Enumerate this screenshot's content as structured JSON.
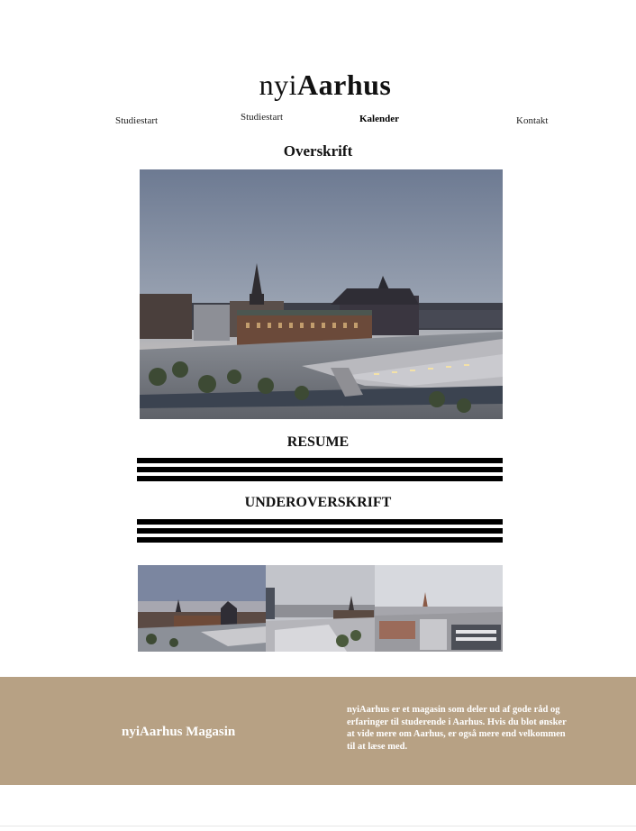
{
  "header": {
    "logo_light": "nyi",
    "logo_bold": "Aarhus"
  },
  "nav": {
    "items": [
      {
        "label": "Studiestart"
      },
      {
        "label": "Studiestart"
      },
      {
        "label": "Kalender"
      },
      {
        "label": "Kontakt"
      }
    ]
  },
  "main": {
    "title": "Overskrift",
    "resume": "RESUME",
    "subheading": "UNDEROVERSKRIFT"
  },
  "footer": {
    "brand": "nyiAarhus Magasin",
    "description": "nyiAarhus er et magasin som deler ud af gode råd og erfaringer til studerende i Aarhus. Hvis du blot ønsker at vide mere om Aarhus, er også mere end velkommen til at læse med."
  },
  "colors": {
    "footer_bg": "#b7a184",
    "bars": "#000000"
  }
}
